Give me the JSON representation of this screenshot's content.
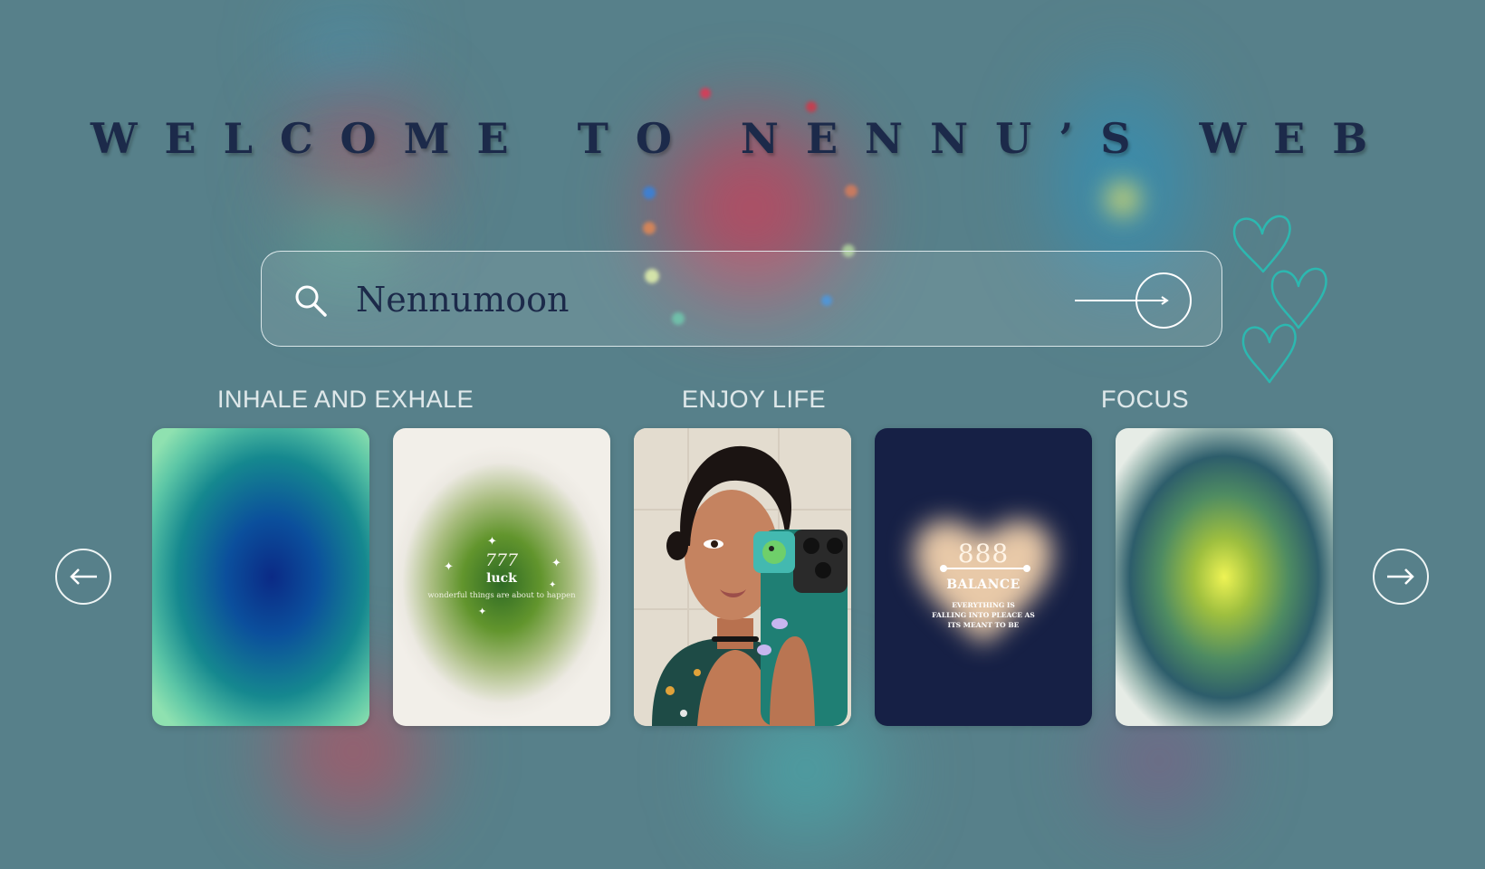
{
  "page": {
    "title": "WELCOME TO NENNU’S WEB"
  },
  "search": {
    "value": "Nennumoon",
    "icon": "search-icon",
    "submit_icon": "arrow-right-circle-icon"
  },
  "categories": [
    {
      "label": "INHALE AND EXHALE"
    },
    {
      "label": "ENJOY LIFE"
    },
    {
      "label": "FOCUS"
    }
  ],
  "cards": [
    {
      "kind": "gradient-blue-aura"
    },
    {
      "kind": "gradient-green-aura",
      "number": "777",
      "title": "luck",
      "subtitle": "wonderful things are about to happen"
    },
    {
      "kind": "selfie-photo"
    },
    {
      "kind": "heart-aura",
      "number": "888",
      "title": "BALANCE",
      "subtitle_lines": [
        "EVERYTHING IS",
        "FALLING INTO PLEACE AS",
        "ITS MEANT TO BE"
      ]
    },
    {
      "kind": "gradient-yellow-aura"
    }
  ],
  "carousel": {
    "prev_icon": "arrow-left-circle-icon",
    "next_icon": "arrow-right-circle-icon"
  },
  "colors": {
    "background": "#57808a",
    "title": "#1c2a4a",
    "label": "#dfe8ea",
    "heart_outline": "#2cb8b0",
    "balance_card": "#162045"
  }
}
